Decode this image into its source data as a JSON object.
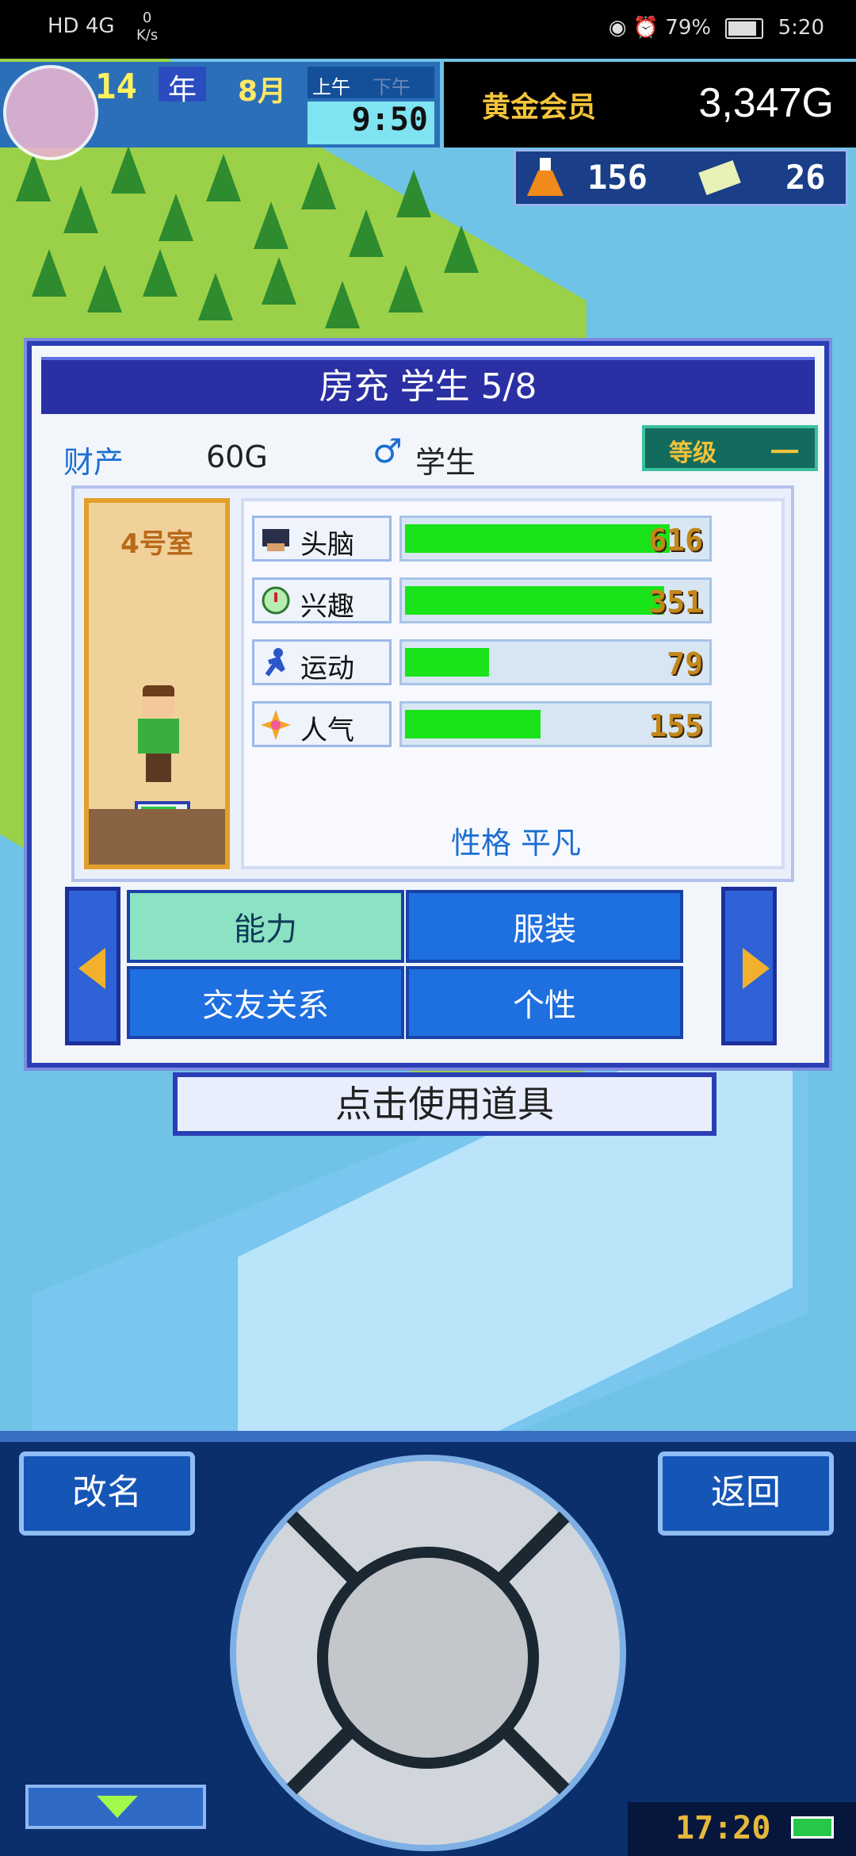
{
  "status_bar": {
    "network": "HD 4G",
    "speed_value": "0",
    "speed_unit": "K/s",
    "battery": "79%",
    "time": "5:20"
  },
  "hud": {
    "year": "14",
    "year_suffix": "年",
    "month": "8月",
    "am": "上午",
    "pm": "下午",
    "time": "9:50",
    "member_label": "黄金会员",
    "gold": "3,347G",
    "research_points": "156",
    "tickets": "26"
  },
  "panel": {
    "title": "房充 学生 5/8",
    "asset_label": "财产",
    "asset_value": "60G",
    "role_label": "学生",
    "grade_label": "等级",
    "grade_value": "一",
    "room_name": "4号室",
    "stats": [
      {
        "label": "头脑",
        "value": "616",
        "level": 0.88
      },
      {
        "label": "兴趣",
        "value": "351",
        "level": 0.86
      },
      {
        "label": "运动",
        "value": "79",
        "level": 0.28
      },
      {
        "label": "人气",
        "value": "155",
        "level": 0.45
      }
    ],
    "personality": "性格 平凡",
    "tabs": [
      "能力",
      "服装",
      "交友关系",
      "个性"
    ]
  },
  "use_item_label": "点击使用道具",
  "controller": {
    "rename": "改名",
    "back": "返回",
    "clock": "17:20"
  },
  "colors": {
    "panel_border": "#2b3fb5",
    "title_bg": "#2a2fa4",
    "stat_fill": "#19e319",
    "tab_blue": "#1e6fe0",
    "tab_active": "#8ce3c3"
  }
}
